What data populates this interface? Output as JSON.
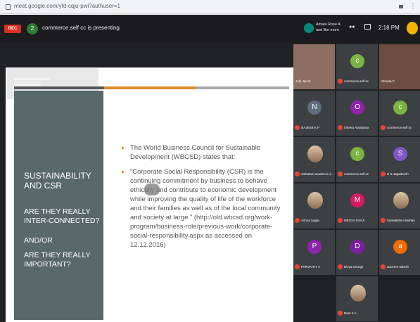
{
  "browser": {
    "url": "meet.google.com/yfd-cqju-pwi?authuser=1"
  },
  "topbar": {
    "rec_label": "REC",
    "participant_count": "2",
    "presenting_text": "commerce.self cc is presenting",
    "presenter_line": "Amala Rose A and like more",
    "time": "2:18 PM"
  },
  "slide": {
    "left_title": "SUSTAINABILITY AND CSR",
    "left_q1": "ARE THEY REALLY INTER-CONNECTED?",
    "left_and": "AND/OR",
    "left_q2": "ARE THEY REALLY IMPORTANT?",
    "bullet1": "The World Business Council for Sustainable Development (WBCSD) states that:",
    "bullet2": "“Corporate Social Responsibility (CSR) is the continuing commitment by business to behave ethically and contribute to economic development while improving the quality of life of the workforce and their families as well as of the local community and society at large.” (http://old.wbcsd.org/work-program/business-role/previous-work/corporate-social-responsibility.aspx as accessed on 12.12.2016)"
  },
  "participants": [
    {
      "name": "Jobi Jacob",
      "initial": "",
      "color": "#8d6e63",
      "video": true
    },
    {
      "name": "commerce.self sc",
      "initial": "c",
      "color": "#7cb342",
      "video": false
    },
    {
      "name": "Shrada P",
      "initial": "",
      "color": "#6d4c41",
      "video": true
    },
    {
      "name": "NAJEEB K.P",
      "initial": "N",
      "color": "#5f6d7e",
      "video": false
    },
    {
      "name": "Olivera Alamanna",
      "initial": "O",
      "color": "#8e24aa",
      "video": false
    },
    {
      "name": "commerce.self sc",
      "initial": "c",
      "color": "#7cb342",
      "video": false
    },
    {
      "name": "ambalam academic s...",
      "initial": "",
      "color": "#c5a27a",
      "video": false,
      "photo": true
    },
    {
      "name": "commerce.self sc",
      "initial": "c",
      "color": "#7cb342",
      "video": false
    },
    {
      "name": "S N Jagadeesh",
      "initial": "S",
      "color": "#7e57c2",
      "video": false
    },
    {
      "name": "Ashna Sagar",
      "initial": "",
      "color": "#c5a27a",
      "video": false,
      "photo": true
    },
    {
      "name": "MELDA SHAJI",
      "initial": "M",
      "color": "#d81b60",
      "video": false
    },
    {
      "name": "Sreelakshmi Mohan",
      "initial": "",
      "color": "#c5a27a",
      "video": false,
      "photo": true
    },
    {
      "name": "PARVATHY A",
      "initial": "P",
      "color": "#8e24aa",
      "video": false
    },
    {
      "name": "Divya George",
      "initial": "D",
      "color": "#7b1fa2",
      "video": false
    },
    {
      "name": "anusree rakesh",
      "initial": "a",
      "color": "#ef6c00",
      "video": false
    },
    {
      "name": "Ram K A",
      "initial": "",
      "color": "#c5a27a",
      "video": false,
      "photo": true
    }
  ]
}
